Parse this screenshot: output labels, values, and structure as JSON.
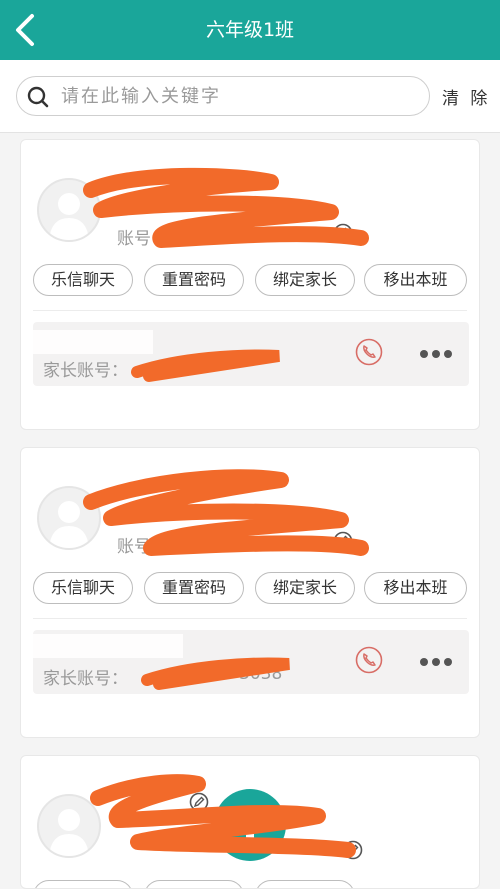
{
  "header": {
    "title": "六年级1班",
    "back_icon": "back-arrow-icon"
  },
  "search": {
    "placeholder": "请在此输入关键字",
    "value": "",
    "clear_label": "清 除"
  },
  "students": [
    {
      "account_prefix": "账号",
      "actions": [
        "乐信聊天",
        "重置密码",
        "绑定家长",
        "移出本班"
      ],
      "parent_account_label": "家长账号：",
      "parent_account_value": ""
    },
    {
      "account_prefix": "账号",
      "actions": [
        "乐信聊天",
        "重置密码",
        "绑定家长",
        "移出本班"
      ],
      "parent_account_label": "家长账号：",
      "parent_account_value": "3038"
    },
    {
      "account_prefix": "",
      "actions": [],
      "parent_account_label": "",
      "parent_account_value": ""
    }
  ],
  "colors": {
    "accent": "#1aa69a",
    "redaction": "#f26a2a",
    "phone_icon": "#d86d66"
  }
}
